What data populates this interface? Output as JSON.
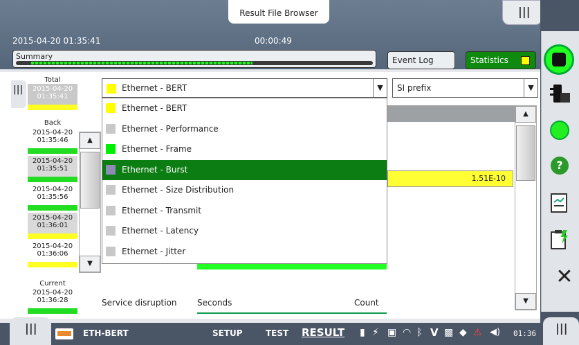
{
  "header": {
    "title": "Result File Browser",
    "datetime": "2015-04-20 01:35:41",
    "elapsed": "00:00:49"
  },
  "summary": {
    "label": "Summary",
    "progress": 0.62
  },
  "buttons": {
    "event_log": "Event Log",
    "statistics": "Statistics"
  },
  "history": {
    "total_label": "Total",
    "total_ts": "2015-04-20\n01:35:41",
    "back_label": "Back",
    "current_label": "Current",
    "entries": [
      {
        "date": "2015-04-20",
        "time": "01:35:46",
        "color": "#22dd22"
      },
      {
        "date": "2015-04-20",
        "time": "01:35:51",
        "color": "#22dd22"
      },
      {
        "date": "2015-04-20",
        "time": "01:35:56",
        "color": "#22dd22"
      },
      {
        "date": "2015-04-20",
        "time": "01:36:01",
        "color": "#ffff22"
      },
      {
        "date": "2015-04-20",
        "time": "01:36:06",
        "color": "#ffff22"
      }
    ],
    "current_date": "2015-04-20",
    "current_time": "01:36:28"
  },
  "dropdown": {
    "selected": "Ethernet - BERT",
    "options": [
      {
        "label": "Ethernet - BERT",
        "color": "#ffff00",
        "selected": false
      },
      {
        "label": "Ethernet - Performance",
        "color": "#c8c8c8",
        "selected": false
      },
      {
        "label": "Ethernet - Frame",
        "color": "#00ee00",
        "selected": false
      },
      {
        "label": "Ethernet - Burst",
        "color": "#8c8cb4",
        "selected": true
      },
      {
        "label": "Ethernet - Size Distribution",
        "color": "#c8c8c8",
        "selected": false
      },
      {
        "label": "Ethernet - Transmit",
        "color": "#c8c8c8",
        "selected": false
      },
      {
        "label": "Ethernet - Latency",
        "color": "#c8c8c8",
        "selected": false
      },
      {
        "label": "Ethernet - Jitter",
        "color": "#c8c8c8",
        "selected": false
      }
    ]
  },
  "prefix": {
    "selected": "SI prefix"
  },
  "table": {
    "ber_value": "1.51E-10"
  },
  "bottom_row": {
    "service_disruption": "Service disruption",
    "seconds": "Seconds",
    "count": "Count"
  },
  "bottombar": {
    "app": "ETH-BERT",
    "setup": "SETUP",
    "test": "TEST",
    "result": "RESULT",
    "clock": "01:36"
  }
}
